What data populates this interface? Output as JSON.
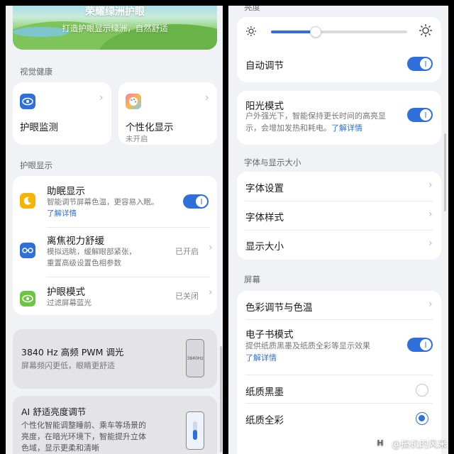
{
  "left": {
    "banner": {
      "title": "荣耀绿洲护眼",
      "subtitle": "打造护眼显示绿洲，自然舒适"
    },
    "section_visual_health": "视觉健康",
    "tile_monitor": {
      "title": "护眼监测",
      "icon": "eye-icon"
    },
    "tile_personal": {
      "title": "个性化显示",
      "status": "未开启",
      "icon": "palette-icon"
    },
    "section_eye_display": "护眼显示",
    "sleep_display": {
      "title": "助眠显示",
      "desc": "智能调节屏幕色温，更容易入眠。",
      "link": "了解详情",
      "on": true
    },
    "defocus": {
      "title": "离焦视力舒缓",
      "desc_line1": "模拟远眺，缓解眼部紧张，",
      "desc_line2": "重置高级设置色相参数",
      "status": "已开启"
    },
    "eye_mode": {
      "title": "护眼模式",
      "desc": "过滤屏幕蓝光",
      "status": "已关闭"
    },
    "pwm": {
      "title": "3840 Hz 高频 PWM 调光",
      "desc": "屏幕频闪更低，眼睛更舒适",
      "thumb_label": "3840Hz"
    },
    "ai_brightness": {
      "title": "AI 舒适亮度调节",
      "desc_line1": "个性化智能调整睡前、乘车等场景的",
      "desc_line2": "亮度，在暗光环境下，智能提升立体",
      "desc_line3": "色域，显示更柔和清晰"
    }
  },
  "right": {
    "brightness_label": "亮度",
    "brightness_level": 0.33,
    "auto_adjust": {
      "title": "自动调节",
      "on": true
    },
    "sunlight": {
      "title": "阳光模式",
      "desc_line1": "户外强光下，智能保持更长时间的高亮显",
      "desc_line2": "示，会增加发热和耗电。",
      "link": "了解详情",
      "on": true
    },
    "section_font": "字体与显示大小",
    "font_settings": "字体设置",
    "font_style": "字体样式",
    "display_size": "显示大小",
    "section_screen": "屏幕",
    "color_temp": "色彩调节与色温",
    "ebook": {
      "title": "电子书模式",
      "desc": "提供纸质黑墨及纸质全彩等显示效果",
      "link": "了解详情",
      "on": true
    },
    "paper_black": {
      "title": "纸质黑墨",
      "selected": false
    },
    "paper_color": {
      "title": "纸质全彩",
      "selected": true
    }
  },
  "watermark": {
    "logo": "H",
    "text": "@搞机的风采"
  },
  "colors": {
    "accent": "#2e6fd9",
    "background": "#f1f2f5",
    "sleep_icon": "#f5b400",
    "defocus_icon": "#2e6fd9",
    "eye_mode_icon": "#6cc644"
  }
}
